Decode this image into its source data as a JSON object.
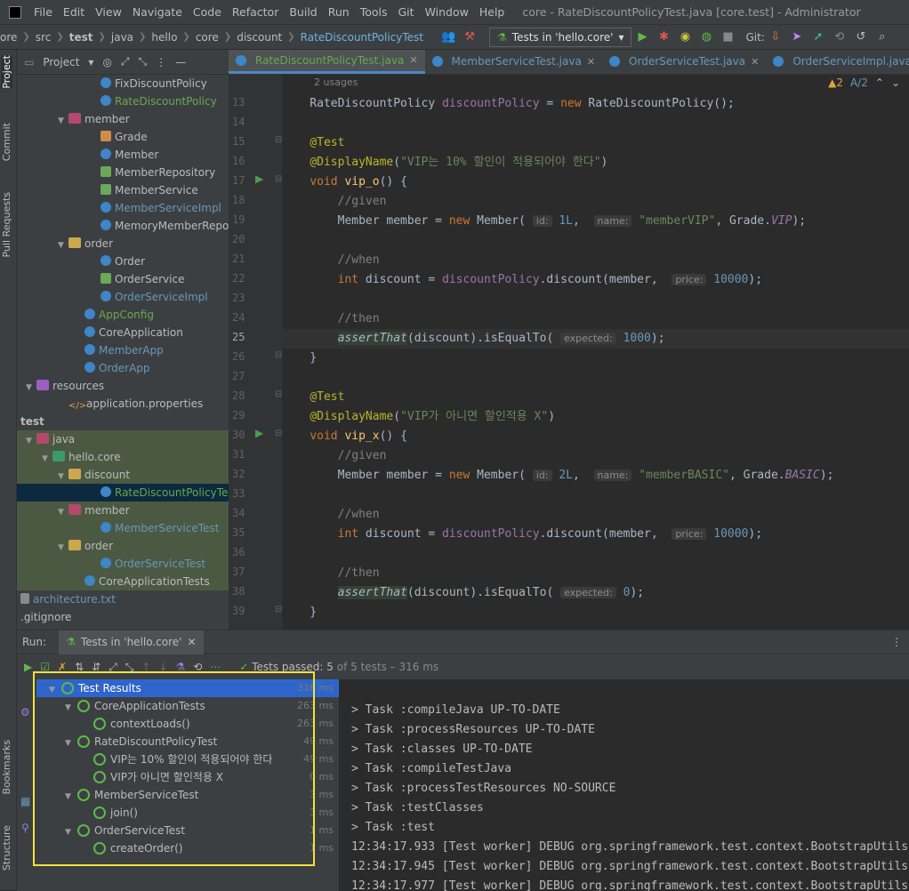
{
  "menubar": {
    "items": [
      "File",
      "Edit",
      "View",
      "Navigate",
      "Code",
      "Refactor",
      "Build",
      "Run",
      "Tools",
      "Git",
      "Window",
      "Help"
    ],
    "window_title": "core - RateDiscountPolicyTest.java [core.test] - Administrator"
  },
  "navbar": {
    "breadcrumbs": [
      "ore",
      "src",
      "test",
      "java",
      "hello",
      "core",
      "discount",
      "RateDiscountPolicyTest"
    ],
    "run_config": "Tests in 'hello.core'",
    "git_label": "Git:"
  },
  "left_strip": {
    "project": "Project",
    "commit": "Commit",
    "pull_requests": "Pull Requests",
    "bookmarks": "Bookmarks",
    "structure": "Structure"
  },
  "project": {
    "title": "Project",
    "tree": [
      {
        "label": "FixDiscountPolicy",
        "icon": "class-icon",
        "indent": 5,
        "color": "normal"
      },
      {
        "label": "RateDiscountPolicy",
        "icon": "class-icon",
        "indent": 5,
        "color": "green"
      },
      {
        "label": "member",
        "icon": "package-icon",
        "indent": 3,
        "arrow": "open"
      },
      {
        "label": "Grade",
        "icon": "enum-icon",
        "indent": 5
      },
      {
        "label": "Member",
        "icon": "class-icon",
        "indent": 5
      },
      {
        "label": "MemberRepository",
        "icon": "interface-icon",
        "indent": 5
      },
      {
        "label": "MemberService",
        "icon": "interface-icon",
        "indent": 5
      },
      {
        "label": "MemberServiceImpl",
        "icon": "class-icon",
        "indent": 5,
        "color": "blue"
      },
      {
        "label": "MemoryMemberRepositor",
        "icon": "class-icon",
        "indent": 5
      },
      {
        "label": "order",
        "icon": "folder-icon",
        "indent": 3,
        "arrow": "open"
      },
      {
        "label": "Order",
        "icon": "class-icon",
        "indent": 5
      },
      {
        "label": "OrderService",
        "icon": "interface-icon",
        "indent": 5
      },
      {
        "label": "OrderServiceImpl",
        "icon": "class-icon",
        "indent": 5,
        "color": "blue"
      },
      {
        "label": "AppConfig",
        "icon": "class-icon",
        "indent": 4,
        "color": "green"
      },
      {
        "label": "CoreApplication",
        "icon": "class-icon",
        "indent": 4
      },
      {
        "label": "MemberApp",
        "icon": "class-icon",
        "indent": 4,
        "color": "blue"
      },
      {
        "label": "OrderApp",
        "icon": "class-icon",
        "indent": 4,
        "color": "blue"
      },
      {
        "label": "resources",
        "icon": "resources-icon",
        "indent": 1,
        "arrow": "open"
      },
      {
        "label": "application.properties",
        "icon": "properties-icon",
        "indent": 3
      },
      {
        "label": "test",
        "icon": "",
        "indent": 0,
        "bold": true
      },
      {
        "label": "java",
        "icon": "package-icon",
        "indent": 1,
        "arrow": "open",
        "hl": true
      },
      {
        "label": "hello.core",
        "icon": "test-icon",
        "indent": 2,
        "arrow": "open",
        "hl": true
      },
      {
        "label": "discount",
        "icon": "folder-icon",
        "indent": 3,
        "arrow": "open",
        "hl": true
      },
      {
        "label": "RateDiscountPolicyTest",
        "icon": "class-icon",
        "indent": 5,
        "color": "green",
        "sel": true
      },
      {
        "label": "member",
        "icon": "package-icon",
        "indent": 3,
        "arrow": "open",
        "hl": true
      },
      {
        "label": "MemberServiceTest",
        "icon": "class-icon",
        "indent": 5,
        "color": "blue",
        "hl": true
      },
      {
        "label": "order",
        "icon": "folder-icon",
        "indent": 3,
        "arrow": "open",
        "hl": true
      },
      {
        "label": "OrderServiceTest",
        "icon": "class-icon",
        "indent": 5,
        "color": "blue",
        "hl": true
      },
      {
        "label": "CoreApplicationTests",
        "icon": "class-icon",
        "indent": 4,
        "hl": true
      },
      {
        "label": "architecture.txt",
        "icon": "text-file-icon",
        "indent": 0,
        "color": "blue"
      },
      {
        "label": ".gitignore",
        "icon": "",
        "indent": 0
      }
    ]
  },
  "editor": {
    "tabs": [
      {
        "label": "RateDiscountPolicyTest.java",
        "active": true
      },
      {
        "label": "MemberServiceTest.java"
      },
      {
        "label": "OrderServiceTest.java"
      },
      {
        "label": "OrderServiceImpl.java"
      }
    ],
    "warnings": "2",
    "weak_warnings": "2",
    "usages": "2 usages",
    "line_numbers": [
      "13",
      "14",
      "15",
      "16",
      "17",
      "18",
      "19",
      "20",
      "21",
      "22",
      "23",
      "24",
      "25",
      "26",
      "27",
      "28",
      "29",
      "30",
      "31",
      "32",
      "33",
      "34",
      "35",
      "36",
      "37",
      "38",
      "39"
    ],
    "current_line": "25"
  },
  "run": {
    "label": "Run:",
    "tab": "Tests in 'hello.core'",
    "passed": "Tests passed: 5",
    "of_total": "of 5 tests – 316 ms",
    "tests": [
      {
        "label": "Test Results",
        "dur": "316 ms",
        "level": 0,
        "sel": true
      },
      {
        "label": "CoreApplicationTests",
        "dur": "263 ms",
        "level": 1
      },
      {
        "label": "contextLoads()",
        "dur": "263 ms",
        "level": 2
      },
      {
        "label": "RateDiscountPolicyTest",
        "dur": "49 ms",
        "level": 1
      },
      {
        "label": "VIP는 10% 할인이 적용되어야 한다",
        "dur": "49 ms",
        "level": 2
      },
      {
        "label": "VIP가 아니면 할인적용 X",
        "dur": "0 ms",
        "level": 2
      },
      {
        "label": "MemberServiceTest",
        "dur": "3 ms",
        "level": 1
      },
      {
        "label": "join()",
        "dur": "3 ms",
        "level": 2
      },
      {
        "label": "OrderServiceTest",
        "dur": "1 ms",
        "level": 1
      },
      {
        "label": "createOrder()",
        "dur": "1 ms",
        "level": 2
      }
    ],
    "console": [
      "> Task :compileJava UP-TO-DATE",
      "> Task :processResources UP-TO-DATE",
      "> Task :classes UP-TO-DATE",
      "> Task :compileTestJava",
      "> Task :processTestResources NO-SOURCE",
      "> Task :testClasses",
      "> Task :test",
      "12:34:17.933 [Test worker] DEBUG org.springframework.test.context.BootstrapUtils",
      "12:34:17.945 [Test worker] DEBUG org.springframework.test.context.BootstrapUtils",
      "12:34:17.977 [Test worker] DEBUG org.springframework.test.context.BootstrapUtils"
    ]
  }
}
